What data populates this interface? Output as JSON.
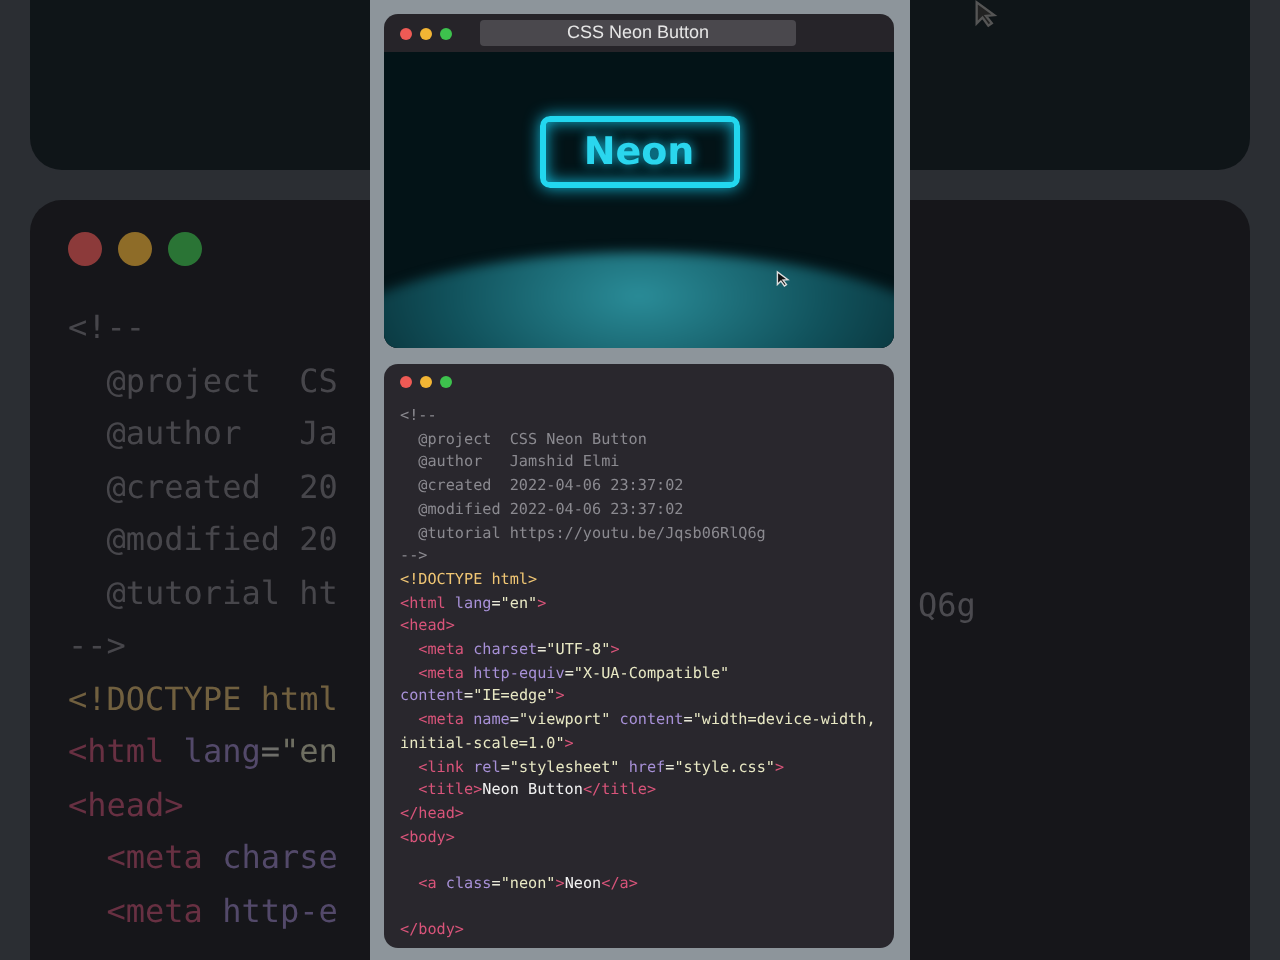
{
  "background": {
    "left_code_lines": [
      [
        {
          "kind": "comment",
          "text": "<!--"
        }
      ],
      [
        {
          "kind": "comment",
          "text": "  @project  CS"
        }
      ],
      [
        {
          "kind": "comment",
          "text": "  @author   Ja"
        }
      ],
      [
        {
          "kind": "comment",
          "text": "  @created  20"
        }
      ],
      [
        {
          "kind": "comment",
          "text": "  @modified 20"
        }
      ],
      [
        {
          "kind": "comment",
          "text": "  @tutorial ht"
        }
      ],
      [
        {
          "kind": "comment",
          "text": "-->"
        }
      ],
      [
        {
          "kind": "doctype",
          "text": "<!DOCTYPE html"
        }
      ],
      [
        {
          "kind": "tag",
          "text": "<html"
        },
        {
          "kind": "attr",
          "text": " lang"
        },
        {
          "kind": "punct",
          "text": "="
        },
        {
          "kind": "string",
          "text": "\"en"
        }
      ],
      [
        {
          "kind": "tag",
          "text": "<head>"
        }
      ],
      [
        {
          "kind": "tag",
          "text": "  <meta"
        },
        {
          "kind": "attr",
          "text": " charse"
        }
      ],
      [
        {
          "kind": "tag",
          "text": "  <meta"
        },
        {
          "kind": "attr",
          "text": " http-e"
        }
      ]
    ],
    "right_code_fragment": "Q6g"
  },
  "preview_window": {
    "title": "CSS Neon Button",
    "button_label": "Neon"
  },
  "code_window": {
    "lines": [
      [
        {
          "kind": "comment",
          "text": "<!--"
        }
      ],
      [
        {
          "kind": "comment",
          "text": "  @project  CSS Neon Button"
        }
      ],
      [
        {
          "kind": "comment",
          "text": "  @author   Jamshid Elmi"
        }
      ],
      [
        {
          "kind": "comment",
          "text": "  @created  2022-04-06 23:37:02"
        }
      ],
      [
        {
          "kind": "comment",
          "text": "  @modified 2022-04-06 23:37:02"
        }
      ],
      [
        {
          "kind": "comment",
          "text": "  @tutorial https://youtu.be/Jqsb06RlQ6g"
        }
      ],
      [
        {
          "kind": "comment",
          "text": "-->"
        }
      ],
      [
        {
          "kind": "doctype",
          "text": "<!DOCTYPE html>"
        }
      ],
      [
        {
          "kind": "tag",
          "text": "<html"
        },
        {
          "kind": "attr",
          "text": " lang"
        },
        {
          "kind": "punct",
          "text": "="
        },
        {
          "kind": "string",
          "text": "\"en\""
        },
        {
          "kind": "tag",
          "text": ">"
        }
      ],
      [
        {
          "kind": "tag",
          "text": "<head>"
        }
      ],
      [
        {
          "kind": "tag",
          "text": "  <meta"
        },
        {
          "kind": "attr",
          "text": " charset"
        },
        {
          "kind": "punct",
          "text": "="
        },
        {
          "kind": "string",
          "text": "\"UTF-8\""
        },
        {
          "kind": "tag",
          "text": ">"
        }
      ],
      [
        {
          "kind": "tag",
          "text": "  <meta"
        },
        {
          "kind": "attr",
          "text": " http-equiv"
        },
        {
          "kind": "punct",
          "text": "="
        },
        {
          "kind": "string",
          "text": "\"X-UA-Compatible\""
        }
      ],
      [
        {
          "kind": "attr",
          "text": "content"
        },
        {
          "kind": "punct",
          "text": "="
        },
        {
          "kind": "string",
          "text": "\"IE=edge\""
        },
        {
          "kind": "tag",
          "text": ">"
        }
      ],
      [
        {
          "kind": "tag",
          "text": "  <meta"
        },
        {
          "kind": "attr",
          "text": " name"
        },
        {
          "kind": "punct",
          "text": "="
        },
        {
          "kind": "string",
          "text": "\"viewport\""
        },
        {
          "kind": "attr",
          "text": " content"
        },
        {
          "kind": "punct",
          "text": "="
        },
        {
          "kind": "string",
          "text": "\"width=device-width,"
        }
      ],
      [
        {
          "kind": "string",
          "text": "initial-scale=1.0\""
        },
        {
          "kind": "tag",
          "text": ">"
        }
      ],
      [
        {
          "kind": "tag",
          "text": "  <link"
        },
        {
          "kind": "attr",
          "text": " rel"
        },
        {
          "kind": "punct",
          "text": "="
        },
        {
          "kind": "string",
          "text": "\"stylesheet\""
        },
        {
          "kind": "attr",
          "text": " href"
        },
        {
          "kind": "punct",
          "text": "="
        },
        {
          "kind": "string",
          "text": "\"style.css\""
        },
        {
          "kind": "tag",
          "text": ">"
        }
      ],
      [
        {
          "kind": "tag",
          "text": "  <title>"
        },
        {
          "kind": "text",
          "text": "Neon Button"
        },
        {
          "kind": "tag",
          "text": "</title>"
        }
      ],
      [
        {
          "kind": "tag",
          "text": "</head>"
        }
      ],
      [
        {
          "kind": "tag",
          "text": "<body>"
        }
      ],
      [
        {
          "kind": "tag",
          "text": "  <a",
          "blank_line_before": true
        },
        {
          "kind": "attr",
          "text": " class"
        },
        {
          "kind": "punct",
          "text": "="
        },
        {
          "kind": "string",
          "text": "\"neon\""
        },
        {
          "kind": "tag",
          "text": ">"
        },
        {
          "kind": "text",
          "text": "Neon"
        },
        {
          "kind": "tag",
          "text": "</a>"
        }
      ],
      [
        {
          "kind": "tag",
          "text": "</body>",
          "blank_line_before": true
        }
      ]
    ]
  }
}
